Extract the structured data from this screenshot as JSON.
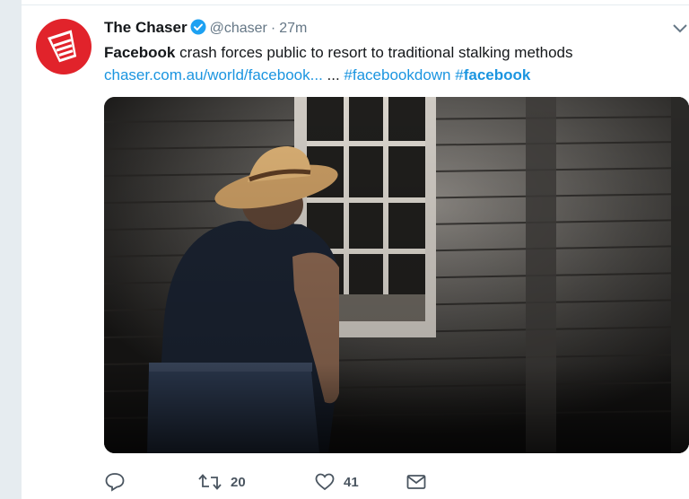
{
  "tweet": {
    "author_name": "The Chaser",
    "handle": "@chaser",
    "separator": "·",
    "time": "27m",
    "text_bold": "Facebook",
    "text_rest": " crash forces public to resort to traditional stalking methods",
    "link": "chaser.com.au/world/facebook...",
    "ellipsis": " ... ",
    "hashtag1": "#facebookdown",
    "hashtag2_hash": " #",
    "hashtag2_word": "facebook",
    "image_icon": "photo-man-peering-through-window",
    "actions": {
      "reply_icon": "reply-icon",
      "retweet_icon": "retweet-icon",
      "retweet_count": "20",
      "like_icon": "heart-icon",
      "like_count": "41",
      "dm_icon": "envelope-icon"
    }
  },
  "colors": {
    "link": "#1b95e0",
    "avatar_bg": "#e1232b",
    "verified": "#1da1f2",
    "muted": "#657786"
  }
}
